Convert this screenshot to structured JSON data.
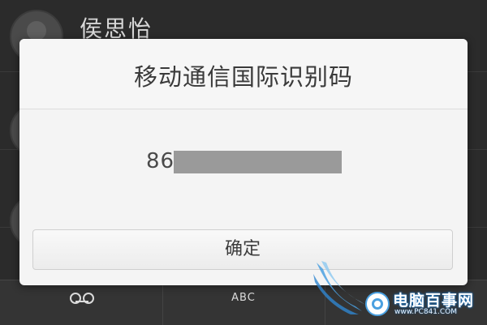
{
  "background": {
    "contact": {
      "name": "侯思怡"
    },
    "dialpad": {
      "keys": [
        "",
        "ABC",
        ""
      ]
    }
  },
  "dialog": {
    "title": "移动通信国际识别码",
    "imei_visible_prefix": "86",
    "confirm_label": "确定"
  },
  "watermark": {
    "brand": "电脑百事网",
    "url": "www.PC841.COM"
  },
  "colors": {
    "dialog_bg": "#f4f4f4",
    "overlay_bg": "#2b2b2b",
    "redaction": "#9a9a9a",
    "watermark_blue": "#1c6fb8"
  }
}
